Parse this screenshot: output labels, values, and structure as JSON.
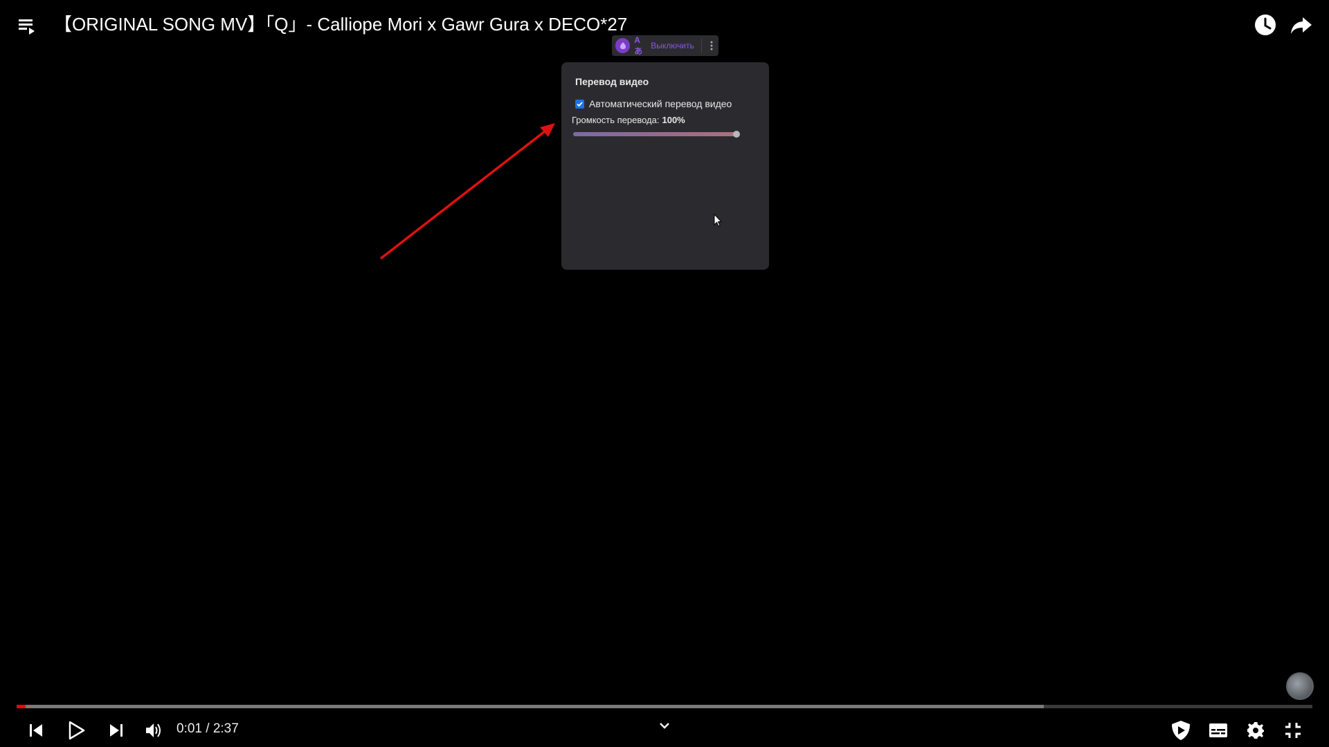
{
  "video": {
    "title": "【ORIGINAL SONG MV】「Q」- Calliope Mori x Gawr Gura x DECO*27"
  },
  "translate_button": {
    "lang_glyph": "Aあ",
    "label": "Выключить",
    "accent_color": "#8a55e6"
  },
  "translate_panel": {
    "title": "Перевод видео",
    "auto_translate_label": "Автоматический перевод видео",
    "auto_translate_checked": true,
    "volume_label": "Громкость перевода:",
    "volume_value": "100%",
    "volume_level": 1.0
  },
  "player": {
    "current_time": "0:01",
    "separator": "/",
    "duration": "2:37",
    "played_fraction": 0.007,
    "buffered_fraction": 0.793,
    "progress_color": "#ff0000"
  },
  "icons": {
    "top": [
      "playlist-icon",
      "watch-later-icon",
      "share-icon"
    ],
    "controls_left": [
      "previous-icon",
      "play-icon",
      "next-icon",
      "volume-icon"
    ],
    "controls_right": [
      "sponsorblock-icon",
      "subtitles-icon",
      "settings-icon",
      "exit-fullscreen-icon"
    ]
  }
}
